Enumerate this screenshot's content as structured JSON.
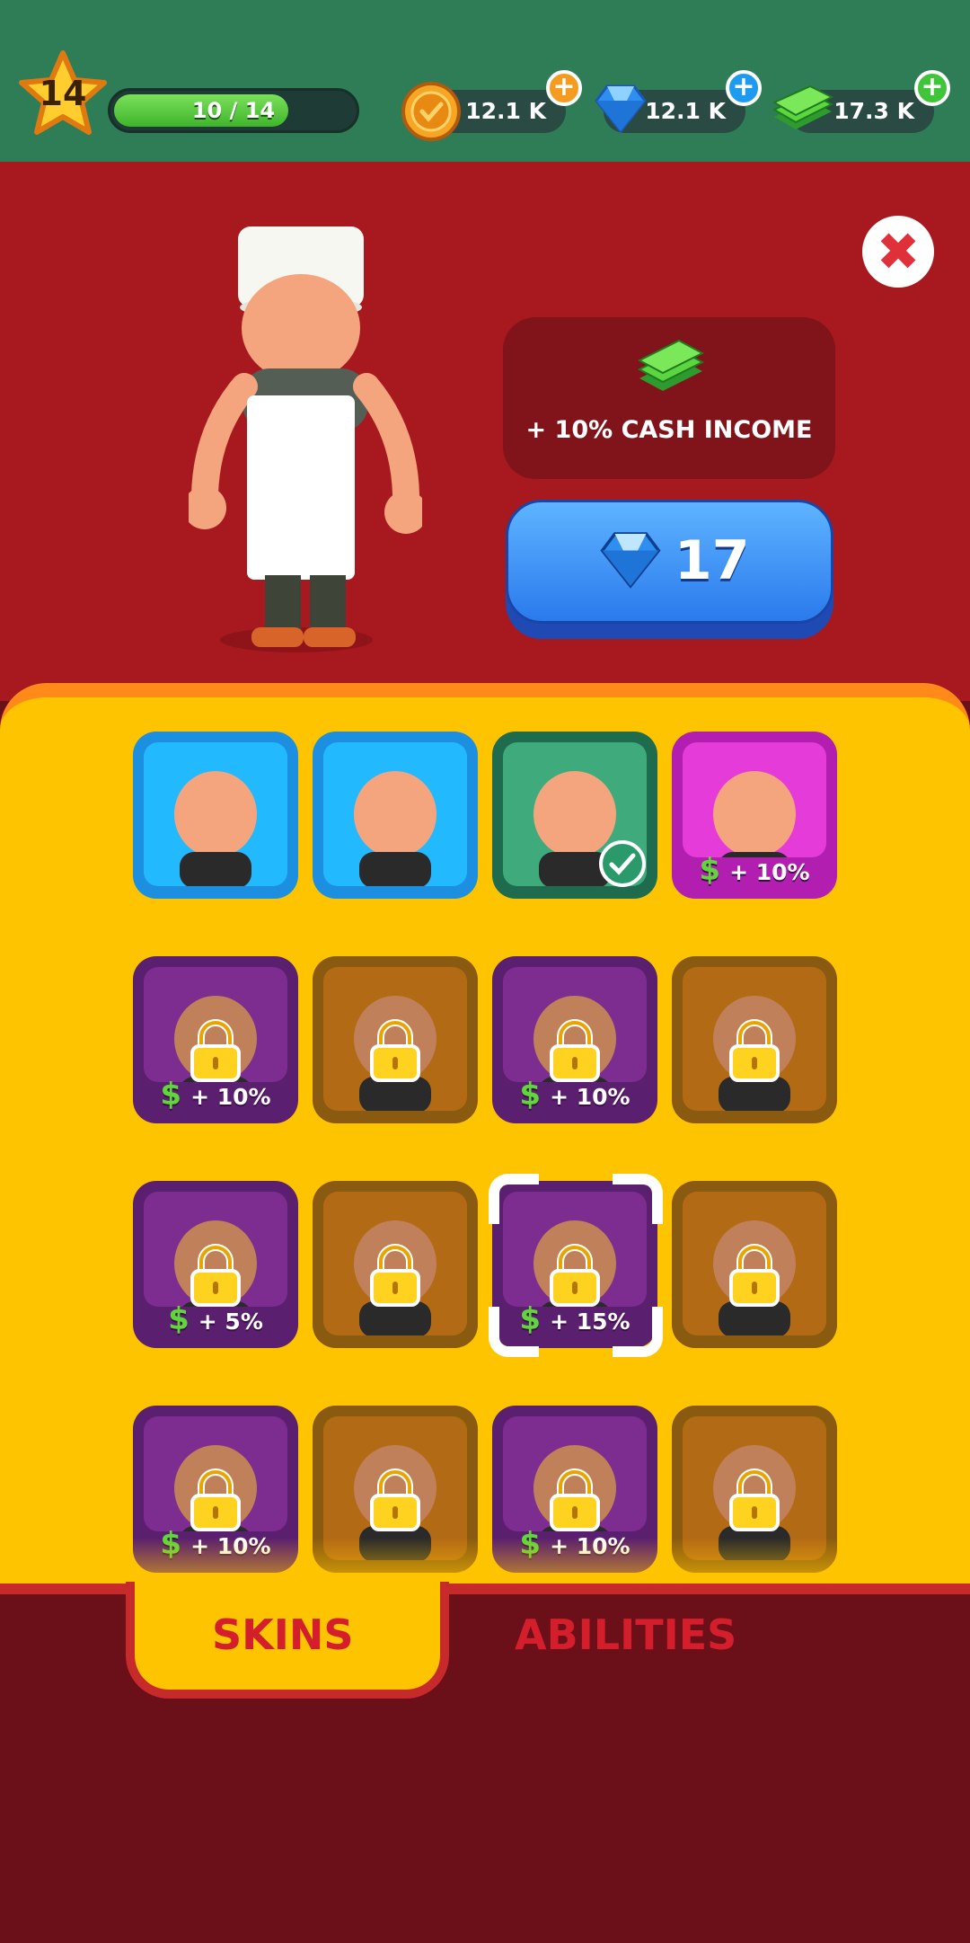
{
  "hud": {
    "level": "14",
    "xp_text": "10 / 14",
    "xp_progress": 0.714,
    "coins": "12.1 K",
    "gems": "12.1 K",
    "cash": "17.3 K"
  },
  "preview": {
    "income_text": "+ 10% CASH INCOME",
    "price": "17",
    "price_icon": "gem-icon"
  },
  "skins": [
    {
      "name": "general",
      "state": "unlocked",
      "bonus": ""
    },
    {
      "name": "santa",
      "state": "unlocked",
      "bonus": ""
    },
    {
      "name": "mafia",
      "state": "equipped",
      "bonus": ""
    },
    {
      "name": "dark-hair",
      "state": "owned-bonus",
      "bonus": "+ 10%"
    },
    {
      "name": "dark-hair-locked",
      "state": "locked",
      "bonus": "+ 10%"
    },
    {
      "name": "beanie",
      "state": "locked",
      "bonus": ""
    },
    {
      "name": "cowboy-cash",
      "state": "locked",
      "bonus": "+ 10%"
    },
    {
      "name": "chef",
      "state": "locked",
      "bonus": ""
    },
    {
      "name": "cowboy-gem",
      "state": "locked",
      "bonus": "+ 5%"
    },
    {
      "name": "beanie-2",
      "state": "locked",
      "bonus": ""
    },
    {
      "name": "cowboy-gem-2",
      "state": "locked",
      "bonus": "+ 15%"
    },
    {
      "name": "chef-2",
      "state": "locked",
      "bonus": ""
    },
    {
      "name": "cowboy-3",
      "state": "locked",
      "bonus": "+ 10%"
    },
    {
      "name": "beanie-3",
      "state": "locked",
      "bonus": ""
    },
    {
      "name": "cowboy-4",
      "state": "locked",
      "bonus": "+ 10%"
    },
    {
      "name": "chef-3",
      "state": "locked",
      "bonus": ""
    }
  ],
  "tabs": {
    "skins": "SKINS",
    "abilities": "ABILITIES"
  },
  "colors": {
    "hud": "#2e7d57",
    "background": "#a8191f",
    "panel": "#ffc400",
    "accent_red": "#d41e2b",
    "buy_button": "#2a7aed"
  }
}
